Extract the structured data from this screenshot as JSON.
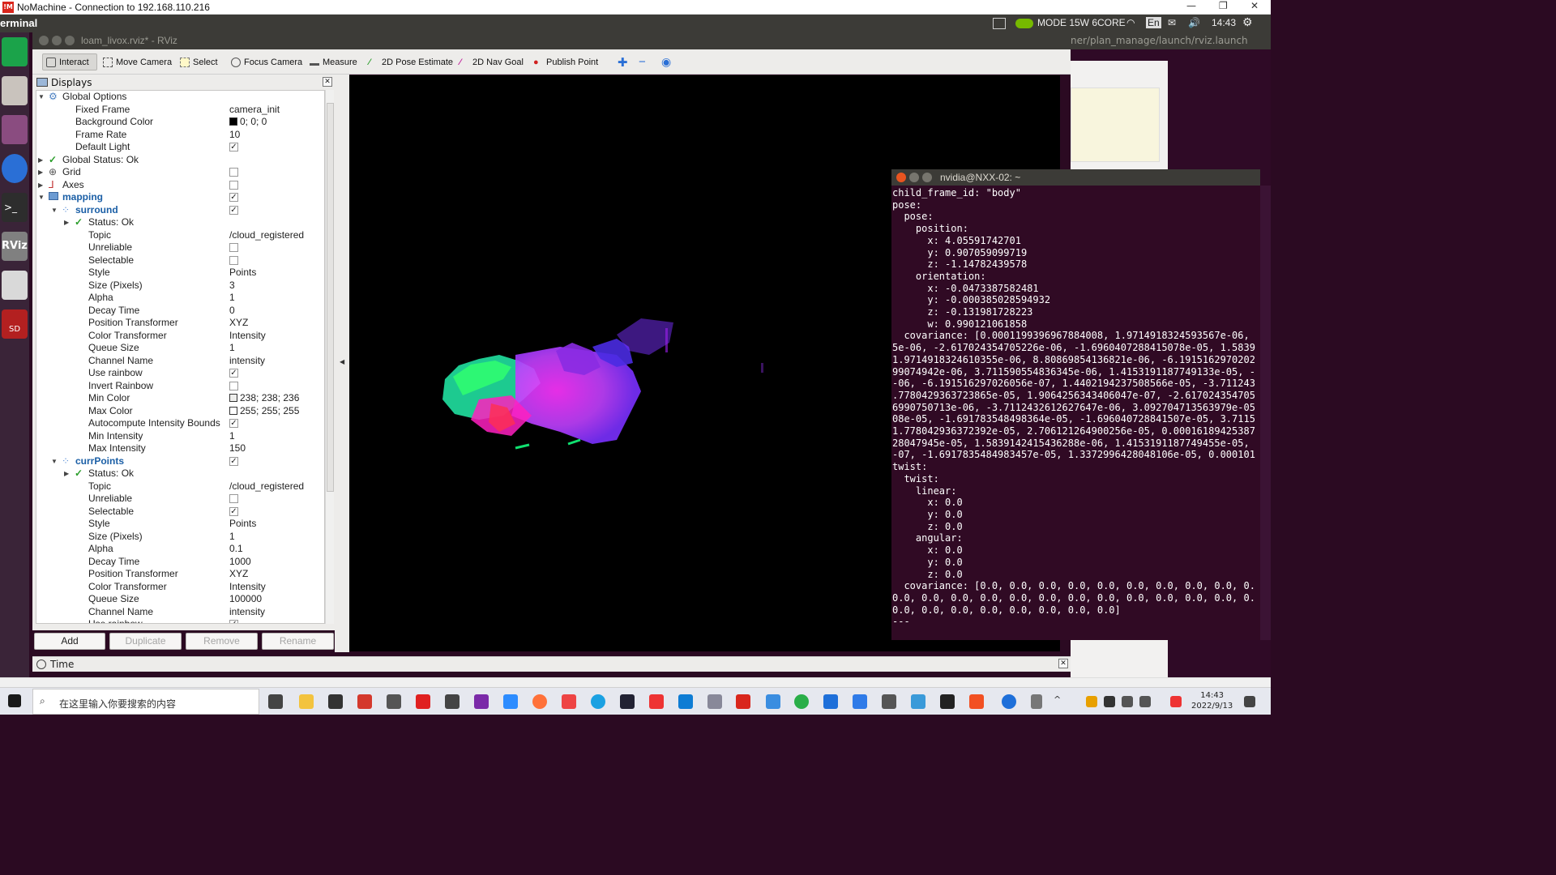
{
  "nomachine": {
    "title": "NoMachine - Connection to 192.168.110.216",
    "logo": "!M"
  },
  "ubuntu_top": {
    "app": "erminal",
    "mode": "MODE 15W 6CORE",
    "lang": "En",
    "time": "14:43"
  },
  "rviz": {
    "window_title": "loam_livox.rviz* - RViz",
    "toolbar": {
      "interact": "Interact",
      "move_camera": "Move Camera",
      "select": "Select",
      "focus_camera": "Focus Camera",
      "measure": "Measure",
      "pose_estimate": "2D Pose Estimate",
      "nav_goal": "2D Nav Goal",
      "publish_point": "Publish Point"
    },
    "displays_title": "Displays",
    "tree": [
      {
        "indent": 0,
        "expand": "open",
        "icon": "gear",
        "label": "Global Options"
      },
      {
        "indent": 1,
        "label": "Fixed Frame",
        "value": "camera_init"
      },
      {
        "indent": 1,
        "label": "Background Color",
        "value": "0; 0; 0",
        "swatch": "#000000"
      },
      {
        "indent": 1,
        "label": "Frame Rate",
        "value": "10"
      },
      {
        "indent": 1,
        "label": "Default Light",
        "check": true
      },
      {
        "indent": 0,
        "expand": "closed",
        "icon": "ok",
        "label": "Global Status: Ok"
      },
      {
        "indent": 0,
        "expand": "closed",
        "icon": "grid",
        "label": "Grid",
        "check": false
      },
      {
        "indent": 0,
        "expand": "closed",
        "icon": "axes",
        "label": "Axes",
        "check": false
      },
      {
        "indent": 0,
        "expand": "open",
        "icon": "folder",
        "label": "mapping",
        "check": true,
        "blue": true
      },
      {
        "indent": 1,
        "expand": "open",
        "icon": "points",
        "label": "surround",
        "check": true,
        "blue": true
      },
      {
        "indent": 2,
        "expand": "closed",
        "icon": "ok",
        "label": "Status: Ok"
      },
      {
        "indent": 2,
        "label": "Topic",
        "value": "/cloud_registered"
      },
      {
        "indent": 2,
        "label": "Unreliable",
        "check": false
      },
      {
        "indent": 2,
        "label": "Selectable",
        "check": false
      },
      {
        "indent": 2,
        "label": "Style",
        "value": "Points"
      },
      {
        "indent": 2,
        "label": "Size (Pixels)",
        "value": "3"
      },
      {
        "indent": 2,
        "label": "Alpha",
        "value": "1"
      },
      {
        "indent": 2,
        "label": "Decay Time",
        "value": "0"
      },
      {
        "indent": 2,
        "label": "Position Transformer",
        "value": "XYZ"
      },
      {
        "indent": 2,
        "label": "Color Transformer",
        "value": "Intensity"
      },
      {
        "indent": 2,
        "label": "Queue Size",
        "value": "1"
      },
      {
        "indent": 2,
        "label": "Channel Name",
        "value": "intensity"
      },
      {
        "indent": 2,
        "label": "Use rainbow",
        "check": true
      },
      {
        "indent": 2,
        "label": "Invert Rainbow",
        "check": false
      },
      {
        "indent": 2,
        "label": "Min Color",
        "value": "238; 238; 236",
        "swatch": "#eeeeec"
      },
      {
        "indent": 2,
        "label": "Max Color",
        "value": "255; 255; 255",
        "swatch": "#ffffff"
      },
      {
        "indent": 2,
        "label": "Autocompute Intensity Bounds",
        "check": true
      },
      {
        "indent": 2,
        "label": "Min Intensity",
        "value": "1"
      },
      {
        "indent": 2,
        "label": "Max Intensity",
        "value": "150"
      },
      {
        "indent": 1,
        "expand": "open",
        "icon": "points",
        "label": "currPoints",
        "check": true,
        "blue": true
      },
      {
        "indent": 2,
        "expand": "closed",
        "icon": "ok",
        "label": "Status: Ok"
      },
      {
        "indent": 2,
        "label": "Topic",
        "value": "/cloud_registered"
      },
      {
        "indent": 2,
        "label": "Unreliable",
        "check": false
      },
      {
        "indent": 2,
        "label": "Selectable",
        "check": true
      },
      {
        "indent": 2,
        "label": "Style",
        "value": "Points"
      },
      {
        "indent": 2,
        "label": "Size (Pixels)",
        "value": "1"
      },
      {
        "indent": 2,
        "label": "Alpha",
        "value": "0.1"
      },
      {
        "indent": 2,
        "label": "Decay Time",
        "value": "1000"
      },
      {
        "indent": 2,
        "label": "Position Transformer",
        "value": "XYZ"
      },
      {
        "indent": 2,
        "label": "Color Transformer",
        "value": "Intensity"
      },
      {
        "indent": 2,
        "label": "Queue Size",
        "value": "100000"
      },
      {
        "indent": 2,
        "label": "Channel Name",
        "value": "intensity"
      },
      {
        "indent": 2,
        "label": "Use rainbow",
        "check": true
      }
    ],
    "buttons": {
      "add": "Add",
      "duplicate": "Duplicate",
      "remove": "Remove",
      "rename": "Rename"
    },
    "time_panel": "Time"
  },
  "background_window_title": "ner/plan_manage/launch/rviz.launch",
  "terminal": {
    "title": "nvidia@NXX-02: ~",
    "lines": [
      "child_frame_id: \"body\"",
      "pose:",
      "  pose:",
      "    position:",
      "      x: 4.05591742701",
      "      y: 0.907059099719",
      "      z: -1.14782439578",
      "    orientation:",
      "      x: -0.0473387582481",
      "      y: -0.000385028594932",
      "      z: -0.131981728223",
      "      w: 0.990121061858",
      "  covariance: [0.0001199396967884008, 1.9714918324593567e-06, ",
      "5e-06, -2.617024354705226e-06, -1.6960407288415078e-05, 1.5839",
      "1.9714918324610355e-06, 8.80869854136821e-06, -6.1915162970202",
      "99074942e-06, 3.711590554836345e-06, 1.4153191187749133e-05, -",
      "-06, -6.191516297026056e-07, 1.4402194237508566e-05, -3.711243",
      ".7780429363723865e-05, 1.9064256343406047e-07, -2.617024354705",
      "6990750713e-06, -3.7112432612627647e-06, 3.092704713563979e-05",
      "08e-05, -1.691783548498364e-05, -1.696040728841507e-05, 3.7115",
      "1.778042936372392e-05, 2.706121264900256e-05, 0.00016189425387",
      "28047945e-05, 1.5839142415436288e-06, 1.4153191187749455e-05, ",
      "-07, -1.6917835484983457e-05, 1.3372996428048106e-05, 0.000101",
      "twist:",
      "  twist:",
      "    linear:",
      "      x: 0.0",
      "      y: 0.0",
      "      z: 0.0",
      "    angular:",
      "      x: 0.0",
      "      y: 0.0",
      "      z: 0.0",
      "  covariance: [0.0, 0.0, 0.0, 0.0, 0.0, 0.0, 0.0, 0.0, 0.0, 0.",
      "0.0, 0.0, 0.0, 0.0, 0.0, 0.0, 0.0, 0.0, 0.0, 0.0, 0.0, 0.0, 0.",
      "0.0, 0.0, 0.0, 0.0, 0.0, 0.0, 0.0, 0.0]",
      "---"
    ]
  },
  "taskbar": {
    "search_placeholder": "在这里输入你要搜索的内容",
    "time": "14:43",
    "date": "2022/9/13"
  },
  "colors": {
    "terminal_bg": "#300a24",
    "ubuntu_bar": "#3c3b37",
    "rviz_panel": "#edecea"
  }
}
